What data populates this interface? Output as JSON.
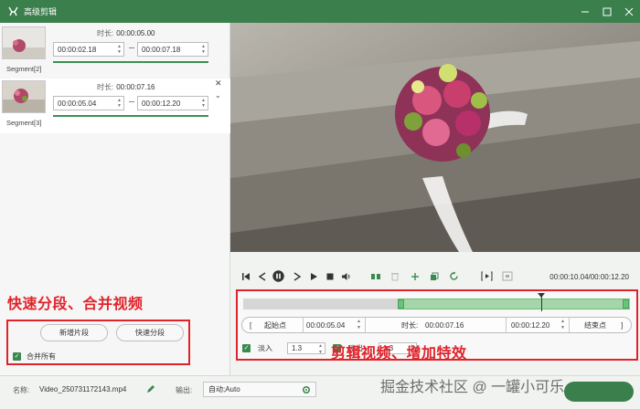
{
  "window": {
    "title": "高级剪辑",
    "minimize_icon": "minimize-icon",
    "maximize_icon": "maximize-icon",
    "close_icon": "close-icon"
  },
  "segments": [
    {
      "label": "Segment[2]",
      "duration_label": "时长:",
      "duration": "00:00:05.00",
      "start": "00:00:02.18",
      "end": "00:00:07.18"
    },
    {
      "label": "Segment[3]",
      "duration_label": "时长:",
      "duration": "00:00:07.16",
      "start": "00:00:05.04",
      "end": "00:00:12.20"
    }
  ],
  "quick": {
    "annotation": "快速分段、合并视频",
    "add_segment": "新增片段",
    "quick_split": "快速分段",
    "merge_all": "合并所有"
  },
  "player": {
    "time_readout": "00:00:10.04/00:00:12.20"
  },
  "edit": {
    "start_label": "起始点",
    "start_value": "00:00:05.04",
    "duration_label": "时长:",
    "duration_value": "00:00:07.16",
    "end_value": "00:00:12.20",
    "end_label": "结束点",
    "fade_in_label": "淡入",
    "fade_in_value": "1.3",
    "fade_out_label": "淡出",
    "fade_out_value": "1.3",
    "selection_start_fraction": 0.4,
    "selection_end_fraction": 1.0,
    "playhead_fraction": 0.77
  },
  "annotation_edit": "剪辑视频、增加特效",
  "bottom": {
    "name_label": "名称:",
    "file_name": "Video_250731172143.mp4",
    "output_label": "输出:",
    "output_value": "自动;Auto"
  },
  "watermark": "掘金技术社区 @ 一罐小可乐",
  "colors": {
    "titlebar": "#3a7f4c",
    "accent": "#3a8a4f",
    "annotation": "#e0232b"
  }
}
